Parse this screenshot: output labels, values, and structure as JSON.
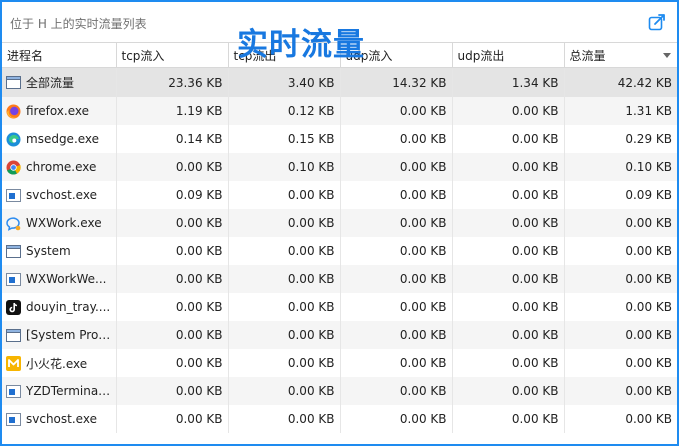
{
  "window": {
    "title": "位于 H 上的实时流量列表",
    "overlay_title": "实时流量"
  },
  "table": {
    "columns": [
      "进程名",
      "tcp流入",
      "tcp流出",
      "udp流入",
      "udp流出",
      "总流量"
    ],
    "sorted_column": "总流量",
    "sort_direction": "descending",
    "total_row": {
      "name": "全部流量",
      "icon": "window-icon",
      "tcp_in": "23.36 KB",
      "tcp_out": "3.40 KB",
      "udp_in": "14.32 KB",
      "udp_out": "1.34 KB",
      "total": "42.42 KB"
    },
    "rows": [
      {
        "name": "firefox.exe",
        "icon": "firefox-icon",
        "tcp_in": "1.19 KB",
        "tcp_out": "0.12 KB",
        "udp_in": "0.00 KB",
        "udp_out": "0.00 KB",
        "total": "1.31 KB"
      },
      {
        "name": "msedge.exe",
        "icon": "edge-icon",
        "tcp_in": "0.14 KB",
        "tcp_out": "0.15 KB",
        "udp_in": "0.00 KB",
        "udp_out": "0.00 KB",
        "total": "0.29 KB"
      },
      {
        "name": "chrome.exe",
        "icon": "chrome-icon",
        "tcp_in": "0.00 KB",
        "tcp_out": "0.10 KB",
        "udp_in": "0.00 KB",
        "udp_out": "0.00 KB",
        "total": "0.10 KB"
      },
      {
        "name": "svchost.exe",
        "icon": "service-icon",
        "tcp_in": "0.09 KB",
        "tcp_out": "0.00 KB",
        "udp_in": "0.00 KB",
        "udp_out": "0.00 KB",
        "total": "0.09 KB"
      },
      {
        "name": "WXWork.exe",
        "icon": "wxwork-icon",
        "tcp_in": "0.00 KB",
        "tcp_out": "0.00 KB",
        "udp_in": "0.00 KB",
        "udp_out": "0.00 KB",
        "total": "0.00 KB"
      },
      {
        "name": "System",
        "icon": "window-icon",
        "tcp_in": "0.00 KB",
        "tcp_out": "0.00 KB",
        "udp_in": "0.00 KB",
        "udp_out": "0.00 KB",
        "total": "0.00 KB"
      },
      {
        "name": "WXWorkWe...",
        "icon": "service-icon",
        "tcp_in": "0.00 KB",
        "tcp_out": "0.00 KB",
        "udp_in": "0.00 KB",
        "udp_out": "0.00 KB",
        "total": "0.00 KB"
      },
      {
        "name": "douyin_tray....",
        "icon": "douyin-icon",
        "tcp_in": "0.00 KB",
        "tcp_out": "0.00 KB",
        "udp_in": "0.00 KB",
        "udp_out": "0.00 KB",
        "total": "0.00 KB"
      },
      {
        "name": "[System Proc...",
        "icon": "window-icon",
        "tcp_in": "0.00 KB",
        "tcp_out": "0.00 KB",
        "udp_in": "0.00 KB",
        "udp_out": "0.00 KB",
        "total": "0.00 KB"
      },
      {
        "name": "小火花.exe",
        "icon": "xiaohuohua-icon",
        "tcp_in": "0.00 KB",
        "tcp_out": "0.00 KB",
        "udp_in": "0.00 KB",
        "udp_out": "0.00 KB",
        "total": "0.00 KB"
      },
      {
        "name": "YZDTerminal...",
        "icon": "service-icon",
        "tcp_in": "0.00 KB",
        "tcp_out": "0.00 KB",
        "udp_in": "0.00 KB",
        "udp_out": "0.00 KB",
        "total": "0.00 KB"
      },
      {
        "name": "svchost.exe",
        "icon": "service-icon",
        "tcp_in": "0.00 KB",
        "tcp_out": "0.00 KB",
        "udp_in": "0.00 KB",
        "udp_out": "0.00 KB",
        "total": "0.00 KB"
      }
    ]
  },
  "colors": {
    "accent": "#1e8bf0",
    "overlay_text": "#1878e0",
    "total_row_bg": "#e4e4e4",
    "stripe_bg": "#f5f5f5"
  }
}
